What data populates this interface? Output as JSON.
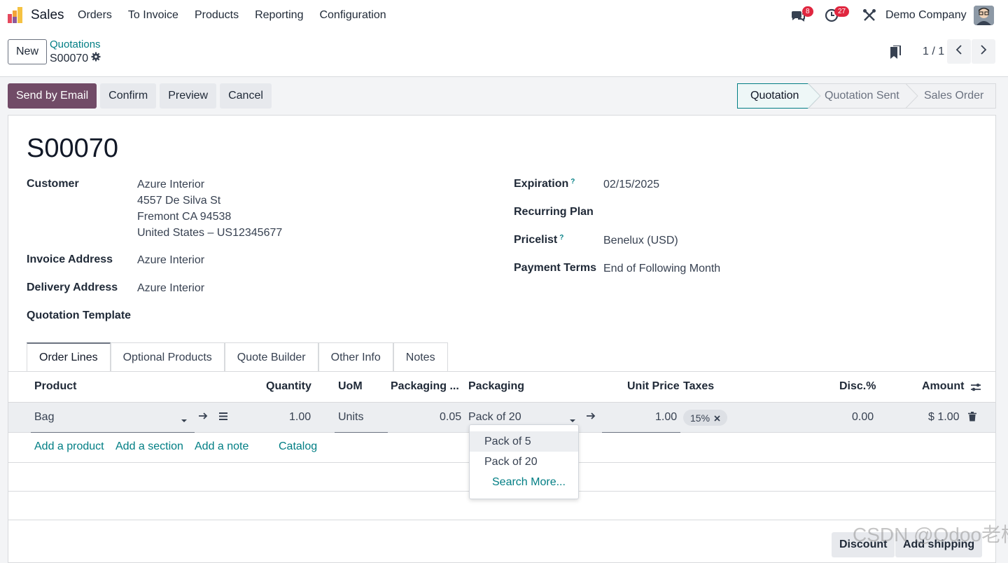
{
  "topbar": {
    "app_name": "Sales",
    "menu": [
      "Orders",
      "To Invoice",
      "Products",
      "Reporting",
      "Configuration"
    ],
    "messages_badge": "8",
    "activities_badge": "27",
    "company": "Demo Company"
  },
  "control_panel": {
    "new_label": "New",
    "breadcrumb_parent": "Quotations",
    "breadcrumb_current": "S00070",
    "pager": "1 / 1"
  },
  "actions": {
    "send_email": "Send by Email",
    "confirm": "Confirm",
    "preview": "Preview",
    "cancel": "Cancel"
  },
  "status": {
    "stages": [
      "Quotation",
      "Quotation Sent",
      "Sales Order"
    ],
    "current": "Quotation"
  },
  "form": {
    "title": "S00070",
    "customer_label": "Customer",
    "customer_lines": [
      "Azure Interior",
      "4557 De Silva St",
      "Fremont CA 94538",
      "United States – US12345677"
    ],
    "invoice_address_label": "Invoice Address",
    "invoice_address": "Azure Interior",
    "delivery_address_label": "Delivery Address",
    "delivery_address": "Azure Interior",
    "quotation_template_label": "Quotation Template",
    "expiration_label": "Expiration",
    "expiration": "02/15/2025",
    "recurring_plan_label": "Recurring Plan",
    "pricelist_label": "Pricelist",
    "pricelist": "Benelux (USD)",
    "payment_terms_label": "Payment Terms",
    "payment_terms": "End of Following Month",
    "help_mark": "?"
  },
  "tabs": [
    "Order Lines",
    "Optional Products",
    "Quote Builder",
    "Other Info",
    "Notes"
  ],
  "table": {
    "headers": {
      "product": "Product",
      "quantity": "Quantity",
      "uom": "UoM",
      "packaging_qty": "Packaging ...",
      "packaging": "Packaging",
      "unit_price": "Unit Price",
      "taxes": "Taxes",
      "disc": "Disc.%",
      "amount": "Amount"
    },
    "row": {
      "product": "Bag",
      "quantity": "1.00",
      "uom": "Units",
      "packaging_qty": "0.05",
      "packaging": "Pack of 20",
      "unit_price": "1.00",
      "tax": "15%",
      "disc": "0.00",
      "amount": "$ 1.00"
    },
    "add_product": "Add a product",
    "add_section": "Add a section",
    "add_note": "Add a note",
    "catalog": "Catalog"
  },
  "dropdown": {
    "options": [
      "Pack of 5",
      "Pack of 20"
    ],
    "search_more": "Search More..."
  },
  "bottom_buttons": {
    "discount": "Discount",
    "add_shipping": "Add shipping"
  },
  "watermark": "CSDN @Odoo老杨",
  "colors": {
    "primary": "#714b67",
    "link": "#017e84",
    "badge": "#e0263f"
  }
}
